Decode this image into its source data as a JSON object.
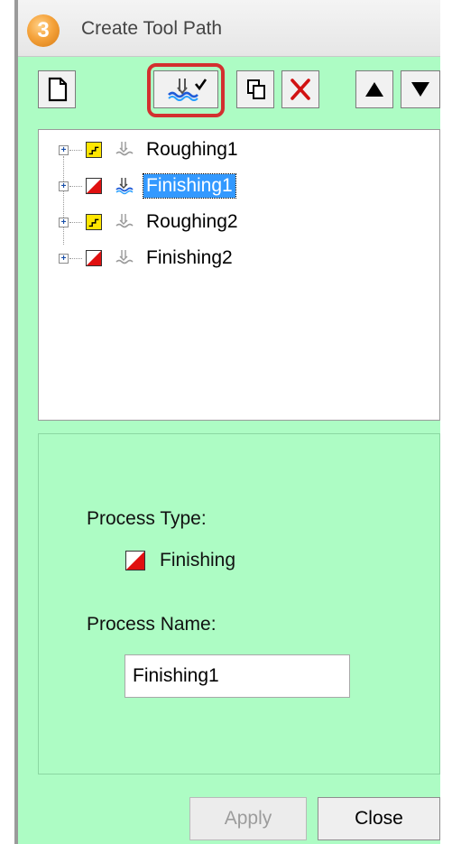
{
  "window": {
    "title": "Create Tool Path",
    "app_icon_glyph": "3"
  },
  "toolbar": {
    "buttons": [
      {
        "name": "new-document-icon"
      },
      {
        "name": "toolpath-check-icon",
        "highlighted": true
      },
      {
        "name": "copy-icon"
      },
      {
        "name": "delete-icon"
      },
      {
        "name": "move-up-icon"
      },
      {
        "name": "move-down-icon"
      }
    ]
  },
  "tree": {
    "expander_glyph": "+",
    "items": [
      {
        "label": "Roughing1",
        "type": "roughing",
        "selected": false
      },
      {
        "label": "Finishing1",
        "type": "finishing",
        "selected": true
      },
      {
        "label": "Roughing2",
        "type": "roughing",
        "selected": false
      },
      {
        "label": "Finishing2",
        "type": "finishing",
        "selected": false
      }
    ]
  },
  "properties": {
    "process_type_label": "Process Type:",
    "process_type_value": "Finishing",
    "process_name_label": "Process Name:",
    "process_name_value": "Finishing1"
  },
  "buttons": {
    "apply": "Apply",
    "close": "Close"
  },
  "colors": {
    "panel_bg": "#adfcc4",
    "selection": "#3399ff",
    "highlight_ring": "#d32f2f",
    "roughing_icon": "#ffe600",
    "finishing_icon": "#e01010"
  }
}
